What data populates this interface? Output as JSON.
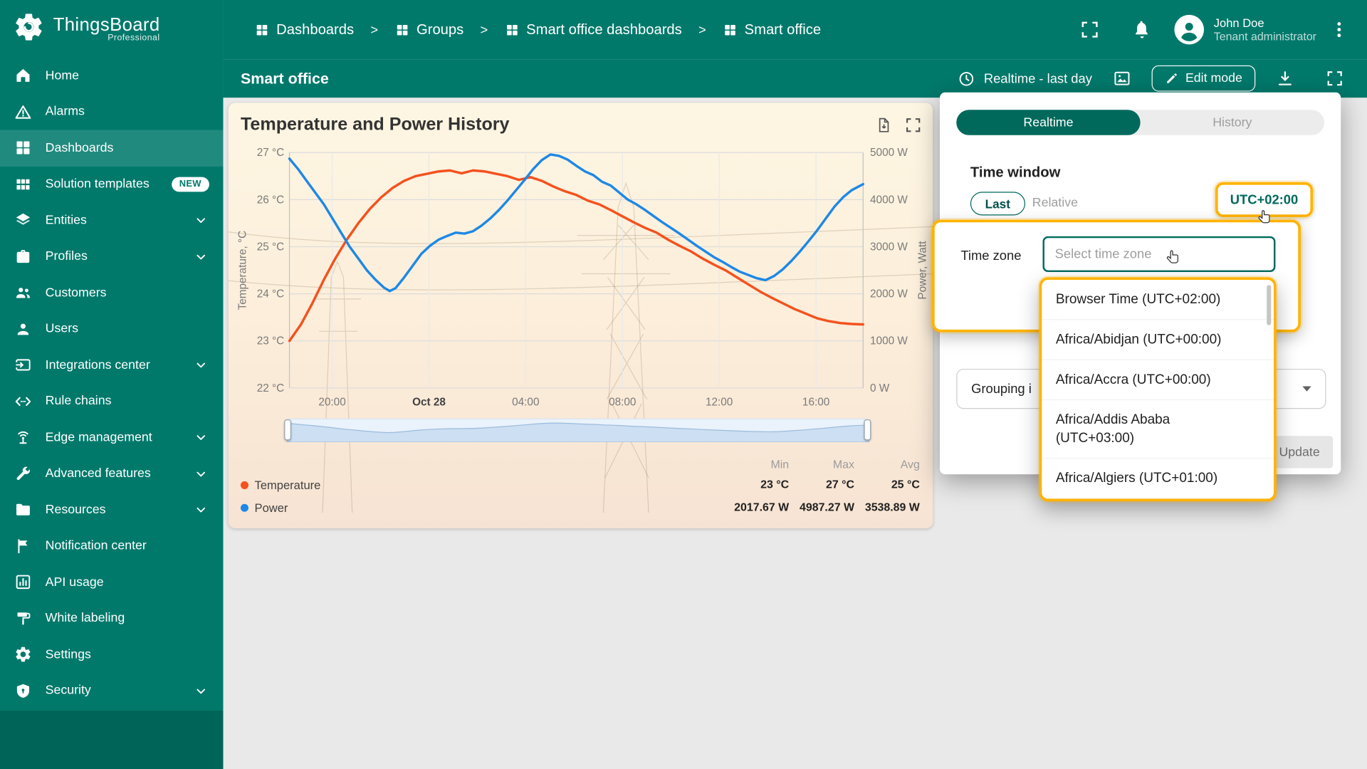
{
  "app": {
    "brand": "ThingsBoard",
    "brand_sub": "Professional"
  },
  "sidebar": {
    "items": [
      {
        "label": "Home",
        "icon": "home-icon"
      },
      {
        "label": "Alarms",
        "icon": "alarms-icon"
      },
      {
        "label": "Dashboards",
        "icon": "dashboards-icon",
        "active": true
      },
      {
        "label": "Solution templates",
        "icon": "solution-templates-icon",
        "badge": "NEW"
      },
      {
        "label": "Entities",
        "icon": "entities-icon",
        "chevron": true
      },
      {
        "label": "Profiles",
        "icon": "profiles-icon",
        "chevron": true
      },
      {
        "label": "Customers",
        "icon": "customers-icon"
      },
      {
        "label": "Users",
        "icon": "users-icon"
      },
      {
        "label": "Integrations center",
        "icon": "integrations-center-icon",
        "chevron": true
      },
      {
        "label": "Rule chains",
        "icon": "rule-chains-icon"
      },
      {
        "label": "Edge management",
        "icon": "edge-management-icon",
        "chevron": true
      },
      {
        "label": "Advanced features",
        "icon": "advanced-features-icon",
        "chevron": true
      },
      {
        "label": "Resources",
        "icon": "resources-icon",
        "chevron": true
      },
      {
        "label": "Notification center",
        "icon": "notification-center-icon"
      },
      {
        "label": "API usage",
        "icon": "api-usage-icon"
      },
      {
        "label": "White labeling",
        "icon": "white-labeling-icon"
      },
      {
        "label": "Settings",
        "icon": "settings-icon"
      },
      {
        "label": "Security",
        "icon": "security-icon",
        "chevron": true
      }
    ]
  },
  "header": {
    "breadcrumbs": [
      "Dashboards",
      "Groups",
      "Smart office dashboards",
      "Smart office"
    ],
    "separator": ">",
    "user": {
      "name": "John Doe",
      "role": "Tenant administrator"
    }
  },
  "toolbar": {
    "title": "Smart office",
    "time_button": "Realtime - last day",
    "edit_button": "Edit mode"
  },
  "widget": {
    "title": "Temperature and Power History"
  },
  "chart_data": {
    "type": "line",
    "title": "Temperature and Power History",
    "x_ticks": [
      "20:00",
      "Oct 28",
      "04:00",
      "08:00",
      "12:00",
      "16:00"
    ],
    "x_tick_fracs": [
      0.0745,
      0.2432,
      0.4118,
      0.5805,
      0.7492,
      0.9179
    ],
    "x_bold_index": 1,
    "y_left": {
      "label": "Temperature, °C",
      "min": 22,
      "max": 27,
      "ticks": [
        "27 °C",
        "26 °C",
        "25 °C",
        "24 °C",
        "23 °C",
        "22 °C"
      ]
    },
    "y_right": {
      "label": "Power, Watt",
      "min": 0,
      "max": 5000,
      "ticks": [
        "5000 W",
        "4000 W",
        "3000 W",
        "2000 W",
        "1000 W",
        "0 W"
      ]
    },
    "series": [
      {
        "name": "Temperature",
        "color": "#f4511e",
        "axis": "left",
        "points": [
          [
            0.0,
            23.0
          ],
          [
            0.02,
            23.35
          ],
          [
            0.04,
            23.8
          ],
          [
            0.06,
            24.3
          ],
          [
            0.08,
            24.75
          ],
          [
            0.1,
            25.15
          ],
          [
            0.12,
            25.5
          ],
          [
            0.14,
            25.8
          ],
          [
            0.16,
            26.05
          ],
          [
            0.18,
            26.25
          ],
          [
            0.2,
            26.4
          ],
          [
            0.22,
            26.5
          ],
          [
            0.24,
            26.55
          ],
          [
            0.26,
            26.6
          ],
          [
            0.28,
            26.62
          ],
          [
            0.3,
            26.56
          ],
          [
            0.32,
            26.62
          ],
          [
            0.34,
            26.6
          ],
          [
            0.36,
            26.55
          ],
          [
            0.38,
            26.5
          ],
          [
            0.4,
            26.42
          ],
          [
            0.42,
            26.48
          ],
          [
            0.44,
            26.4
          ],
          [
            0.46,
            26.28
          ],
          [
            0.48,
            26.18
          ],
          [
            0.5,
            26.1
          ],
          [
            0.52,
            25.98
          ],
          [
            0.54,
            25.9
          ],
          [
            0.56,
            25.78
          ],
          [
            0.58,
            25.65
          ],
          [
            0.6,
            25.52
          ],
          [
            0.62,
            25.4
          ],
          [
            0.64,
            25.3
          ],
          [
            0.66,
            25.15
          ],
          [
            0.68,
            25.02
          ],
          [
            0.7,
            24.9
          ],
          [
            0.72,
            24.75
          ],
          [
            0.74,
            24.62
          ],
          [
            0.76,
            24.5
          ],
          [
            0.78,
            24.35
          ],
          [
            0.8,
            24.2
          ],
          [
            0.82,
            24.05
          ],
          [
            0.84,
            23.92
          ],
          [
            0.86,
            23.8
          ],
          [
            0.88,
            23.68
          ],
          [
            0.9,
            23.58
          ],
          [
            0.92,
            23.48
          ],
          [
            0.94,
            23.42
          ],
          [
            0.96,
            23.38
          ],
          [
            0.98,
            23.36
          ],
          [
            1.0,
            23.35
          ]
        ]
      },
      {
        "name": "Power",
        "color": "#1e88e5",
        "axis": "right",
        "points": [
          [
            0.0,
            4870
          ],
          [
            0.015,
            4650
          ],
          [
            0.03,
            4400
          ],
          [
            0.045,
            4150
          ],
          [
            0.06,
            3900
          ],
          [
            0.075,
            3600
          ],
          [
            0.09,
            3300
          ],
          [
            0.105,
            3000
          ],
          [
            0.12,
            2750
          ],
          [
            0.135,
            2500
          ],
          [
            0.15,
            2300
          ],
          [
            0.165,
            2130
          ],
          [
            0.175,
            2060
          ],
          [
            0.185,
            2120
          ],
          [
            0.2,
            2350
          ],
          [
            0.215,
            2600
          ],
          [
            0.23,
            2850
          ],
          [
            0.245,
            3020
          ],
          [
            0.26,
            3150
          ],
          [
            0.275,
            3230
          ],
          [
            0.29,
            3300
          ],
          [
            0.305,
            3280
          ],
          [
            0.32,
            3330
          ],
          [
            0.335,
            3450
          ],
          [
            0.35,
            3600
          ],
          [
            0.365,
            3780
          ],
          [
            0.38,
            3980
          ],
          [
            0.395,
            4200
          ],
          [
            0.41,
            4420
          ],
          [
            0.425,
            4650
          ],
          [
            0.44,
            4840
          ],
          [
            0.455,
            4960
          ],
          [
            0.47,
            4930
          ],
          [
            0.485,
            4850
          ],
          [
            0.5,
            4720
          ],
          [
            0.515,
            4600
          ],
          [
            0.53,
            4520
          ],
          [
            0.545,
            4380
          ],
          [
            0.56,
            4300
          ],
          [
            0.575,
            4150
          ],
          [
            0.59,
            4000
          ],
          [
            0.605,
            3900
          ],
          [
            0.62,
            3780
          ],
          [
            0.635,
            3650
          ],
          [
            0.65,
            3520
          ],
          [
            0.665,
            3400
          ],
          [
            0.68,
            3280
          ],
          [
            0.695,
            3150
          ],
          [
            0.71,
            3020
          ],
          [
            0.725,
            2900
          ],
          [
            0.74,
            2780
          ],
          [
            0.755,
            2680
          ],
          [
            0.77,
            2570
          ],
          [
            0.785,
            2470
          ],
          [
            0.8,
            2400
          ],
          [
            0.815,
            2330
          ],
          [
            0.83,
            2290
          ],
          [
            0.845,
            2380
          ],
          [
            0.86,
            2520
          ],
          [
            0.875,
            2700
          ],
          [
            0.89,
            2900
          ],
          [
            0.905,
            3120
          ],
          [
            0.92,
            3350
          ],
          [
            0.935,
            3600
          ],
          [
            0.95,
            3850
          ],
          [
            0.965,
            4050
          ],
          [
            0.98,
            4200
          ],
          [
            1.0,
            4330
          ]
        ]
      }
    ],
    "stats": {
      "headers": [
        "Min",
        "Max",
        "Avg"
      ],
      "rows": [
        {
          "name": "Temperature",
          "color": "#f4511e",
          "min": "23 °C",
          "max": "27 °C",
          "avg": "25 °C"
        },
        {
          "name": "Power",
          "color": "#1e88e5",
          "min": "2017.67 W",
          "max": "4987.27 W",
          "avg": "3538.89 W"
        }
      ]
    }
  },
  "panel": {
    "tabs": [
      "Realtime",
      "History"
    ],
    "active_tab": "Realtime",
    "section_title": "Time window",
    "last_label": "Last",
    "relative_label": "Relative",
    "timezone_button": "UTC+02:00",
    "timezone_field_label": "Time zone",
    "timezone_placeholder": "Select time zone",
    "grouping_label": "Grouping i",
    "update_label": "Update",
    "options": [
      "Browser Time (UTC+02:00)",
      "Africa/Abidjan (UTC+00:00)",
      "Africa/Accra (UTC+00:00)",
      "Africa/Addis Ababa (UTC+03:00)",
      "Africa/Algiers (UTC+01:00)"
    ]
  },
  "colors": {
    "primary": "#00796b",
    "primary_dark": "#00695c",
    "temperature": "#f4511e",
    "power": "#1e88e5",
    "highlight": "#ffb300"
  }
}
